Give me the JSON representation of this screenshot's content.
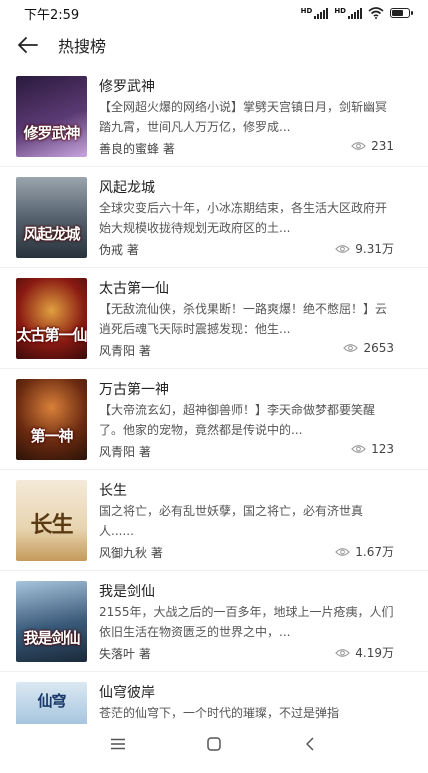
{
  "status_bar": {
    "time": "下午2:59",
    "signal1_label": "HD",
    "signal2_label": "HD"
  },
  "header": {
    "title": "热搜榜",
    "back_icon": "arrow-left-icon"
  },
  "books": [
    {
      "title": "修罗武神",
      "cover_text": "修罗武神",
      "description": "【全网超火爆的网络小说】掌劈天宫镇日月，剑斩幽冥踏九霄，世间凡人万万亿，修罗成...",
      "author": "善良的蜜蜂 著",
      "views": "231",
      "cover_colors": [
        "#2a1a3c",
        "#5b3a74",
        "#c9a6e0"
      ]
    },
    {
      "title": "风起龙城",
      "cover_text": "风起龙城",
      "description": "全球灾变后六十年，小冰冻期结束，各生活大区政府开始大规模收拢待规划无政府区的土...",
      "author": "伪戒 著",
      "views": "9.31万",
      "cover_colors": [
        "#28323c",
        "#56626e",
        "#9aa5ae"
      ]
    },
    {
      "title": "太古第一仙",
      "cover_text": "太古第一仙",
      "description": "【无敌流仙侠，杀伐果断！一路爽爆！绝不憋屈！】云逍死后魂飞天际时震撼发现：他生...",
      "author": "风青阳 著",
      "views": "2653",
      "cover_colors": [
        "#3a0a0a",
        "#8a1a12",
        "#e0a040"
      ]
    },
    {
      "title": "万古第一神",
      "cover_text": "第一神",
      "description": "【大帝流玄幻，超神御兽师！】李天命做梦都要笑醒了。他家的宠物，竟然都是传说中的...",
      "author": "风青阳 著",
      "views": "123",
      "cover_colors": [
        "#2a1208",
        "#6a2a10",
        "#d9803a"
      ]
    },
    {
      "title": "长生",
      "cover_text": "长生",
      "description": "国之将亡，必有乱世妖孽，国之将亡，必有济世真人......",
      "author": "风御九秋 著",
      "views": "1.67万",
      "cover_colors": [
        "#f4ead8",
        "#e8d4b0",
        "#c49a5a"
      ]
    },
    {
      "title": "我是剑仙",
      "cover_text": "我是剑仙",
      "description": "2155年，大战之后的一百多年，地球上一片疮痍，人们依旧生活在物资匮乏的世界之中，...",
      "author": "失落叶 著",
      "views": "4.19万",
      "cover_colors": [
        "#1a2a3a",
        "#3a5a7a",
        "#a8c4dc"
      ]
    },
    {
      "title": "仙穹彼岸",
      "cover_text": "仙穹",
      "description": "苍茫的仙穹下，一个时代的璀璨，不过是弹指",
      "author": "",
      "views": "",
      "cover_colors": [
        "#dbe8f2",
        "#9fc0dc",
        "#3a6a9a"
      ]
    }
  ],
  "nav_bar": {
    "menu_icon": "menu-icon",
    "home_icon": "square-home-icon",
    "back_icon": "triangle-back-icon"
  }
}
